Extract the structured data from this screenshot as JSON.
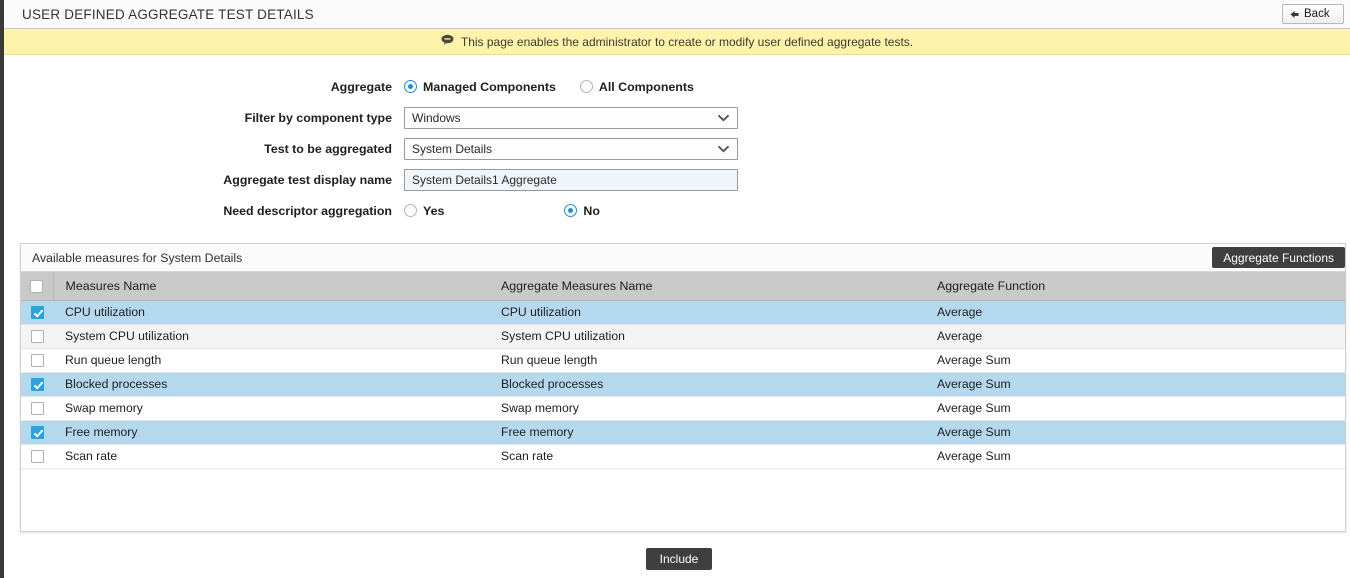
{
  "header": {
    "title": "USER DEFINED AGGREGATE TEST DETAILS",
    "back_label": "Back",
    "back_icon": "left-arrow-icon"
  },
  "banner": {
    "icon": "speech-bubble-icon",
    "message": "This page enables the administrator to create or modify user defined aggregate tests."
  },
  "form": {
    "aggregate": {
      "label": "Aggregate",
      "options": [
        {
          "label": "Managed Components",
          "selected": true
        },
        {
          "label": "All Components",
          "selected": false
        }
      ]
    },
    "filter_by_component_type": {
      "label": "Filter by component type",
      "value": "Windows",
      "chevron": "chevron-down-icon"
    },
    "test_to_be_aggregated": {
      "label": "Test to be aggregated",
      "value": "System Details",
      "chevron": "chevron-down-icon"
    },
    "aggregate_test_display_name": {
      "label": "Aggregate test display name",
      "value": "System Details1 Aggregate",
      "placeholder": ""
    },
    "need_descriptor_aggregation": {
      "label": "Need descriptor aggregation",
      "options": [
        {
          "label": "Yes",
          "selected": false
        },
        {
          "label": "No",
          "selected": true
        }
      ]
    }
  },
  "panel": {
    "title": "Available measures for System Details",
    "aggregate_functions_label": "Aggregate Functions",
    "columns": [
      "Measures Name",
      "Aggregate Measures Name",
      "Aggregate Function"
    ],
    "header_checkbox_checked": false,
    "rows": [
      {
        "checked": true,
        "measure": "CPU utilization",
        "aggregate_measure": "CPU utilization",
        "function": "Average"
      },
      {
        "checked": false,
        "measure": "System CPU utilization",
        "aggregate_measure": "System CPU utilization",
        "function": "Average"
      },
      {
        "checked": false,
        "measure": "Run queue length",
        "aggregate_measure": "Run queue length",
        "function": "Average Sum"
      },
      {
        "checked": true,
        "measure": "Blocked processes",
        "aggregate_measure": "Blocked processes",
        "function": "Average Sum"
      },
      {
        "checked": false,
        "measure": "Swap memory",
        "aggregate_measure": "Swap memory",
        "function": "Average Sum"
      },
      {
        "checked": true,
        "measure": "Free memory",
        "aggregate_measure": "Free memory",
        "function": "Average Sum"
      },
      {
        "checked": false,
        "measure": "Scan rate",
        "aggregate_measure": "Scan rate",
        "function": "Average Sum"
      }
    ]
  },
  "footer": {
    "include_label": "Include"
  },
  "colors": {
    "banner_bg": "#fdf3ab",
    "selected_row": "#b4d9ef",
    "accent": "#1a93d4",
    "checkbox_on": "#28a3e0",
    "dark_button": "#3f3f3f",
    "grid_header": "#c9c9c9"
  }
}
